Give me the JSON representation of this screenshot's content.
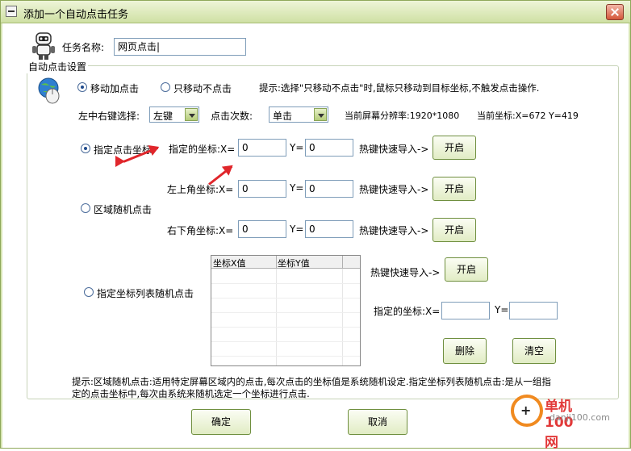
{
  "window": {
    "title": "添加一个自动点击任务"
  },
  "task": {
    "name_label": "任务名称:",
    "name_value": "网页点击|"
  },
  "group": {
    "legend": "自动点击设置"
  },
  "mode": {
    "move_click": "移动加点击",
    "move_only": "只移动不点击",
    "tip": "提示:选择\"只移动不点击\"时,鼠标只移动到目标坐标,不触发点击操作."
  },
  "buttons_select": {
    "label": "左中右键选择:",
    "value": "左键"
  },
  "click_count": {
    "label": "点击次数:",
    "value": "单击"
  },
  "screen": {
    "resolution_label": "当前屏幕分辨率:1920*1080",
    "coord_label": "当前坐标:X=672  Y=419"
  },
  "fixed": {
    "radio_label": "指定点击坐标",
    "coord_label": "指定的坐标:X=",
    "x": "0",
    "y_label": "Y=",
    "y": "0",
    "hotkey": "热键快速导入->",
    "start": "开启"
  },
  "area": {
    "radio_label": "区域随机点击",
    "top_left_label": "左上角坐标:X=",
    "tl_x": "0",
    "y_label": "Y=",
    "tl_y": "0",
    "hotkey1": "热键快速导入->",
    "start1": "开启",
    "bottom_right_label": "右下角坐标:X=",
    "br_x": "0",
    "br_y": "0",
    "hotkey2": "热键快速导入->",
    "start2": "开启"
  },
  "list_mode": {
    "radio_label": "指定坐标列表随机点击",
    "col_x": "坐标X值",
    "col_y": "坐标Y值",
    "hotkey": "热键快速导入->",
    "start": "开启",
    "coord_label": "指定的坐标:X=",
    "y_label": "Y=",
    "x": "",
    "y": "",
    "delete": "删除",
    "clear": "清空"
  },
  "hint": {
    "line1": "提示:区域随机点击:适用特定屏幕区域内的点击,每次点击的坐标值是系统随机设定.指定坐标列表随机点击:是从一组指",
    "line2": "定的点击坐标中,每次由系统来随机选定一个坐标进行点击."
  },
  "footer": {
    "ok": "确定",
    "cancel": "取消"
  },
  "watermark": {
    "brand": "单机100网",
    "url": "danji100.com"
  },
  "colors": {
    "title_bar": "#d6e5b3",
    "arrow": "#e0262b",
    "watermark_red": "#e23a3a",
    "watermark_orange": "#f08a20"
  }
}
